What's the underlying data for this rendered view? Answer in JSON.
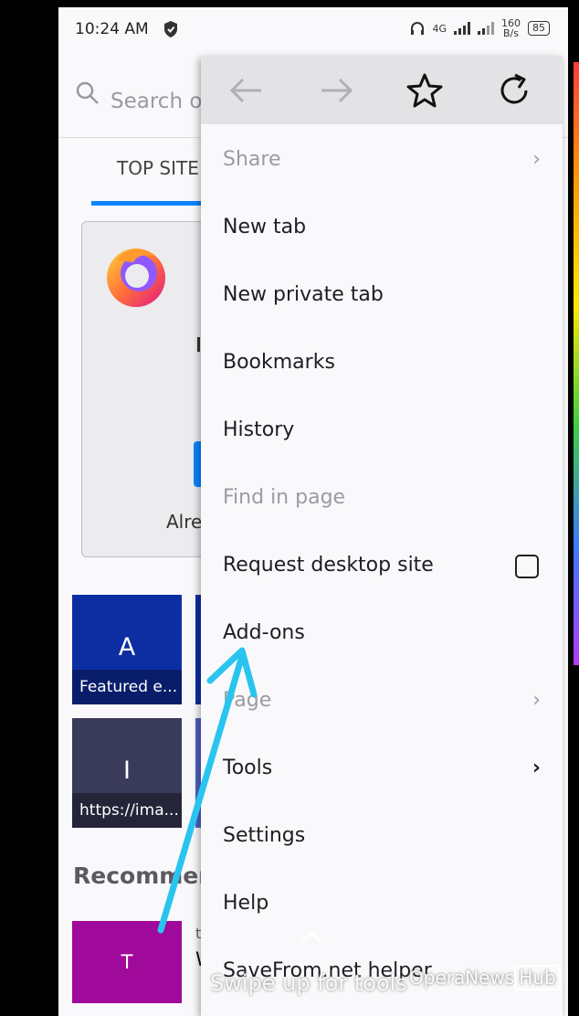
{
  "status_bar": {
    "time": "10:24 AM",
    "network": "4G",
    "speed_value": "160",
    "speed_unit": "B/s",
    "battery": "85"
  },
  "background": {
    "search_placeholder": "Search o",
    "tab_label": "TOP SITE",
    "onboard_partial_text": "Alre",
    "tiles": [
      {
        "letter": "A",
        "caption": "Featured e..."
      },
      {
        "letter": "I",
        "caption": "https://ima..."
      }
    ],
    "recommended_heading": "Recommen",
    "recommended_thumb_letter": "T",
    "recommended_title_partial": "W",
    "recommended_source_partial": "t"
  },
  "menu": {
    "items": [
      {
        "label": "Share",
        "disabled": true,
        "chevron": true
      },
      {
        "label": "New tab"
      },
      {
        "label": "New private tab"
      },
      {
        "label": "Bookmarks"
      },
      {
        "label": "History"
      },
      {
        "label": "Find in page",
        "disabled": true
      },
      {
        "label": "Request desktop site",
        "checkbox": true,
        "checked": false
      },
      {
        "label": "Add-ons"
      },
      {
        "label": "Page",
        "disabled": true,
        "chevron": true
      },
      {
        "label": "Tools",
        "chevron": true
      },
      {
        "label": "Settings"
      },
      {
        "label": "Help"
      },
      {
        "label": "SaveFrom.net helper"
      }
    ]
  },
  "overlay": {
    "swipe_hint": "Swipe up for tools",
    "watermark_brand": "OperaNews",
    "watermark_suffix": "Hub"
  },
  "colors": {
    "accent": "#0a84ff",
    "arrow": "#29c4f0",
    "tile_a": "#0d2ea3",
    "tile_i": "#3a3a5a",
    "recommend_thumb": "#a00a9a"
  }
}
